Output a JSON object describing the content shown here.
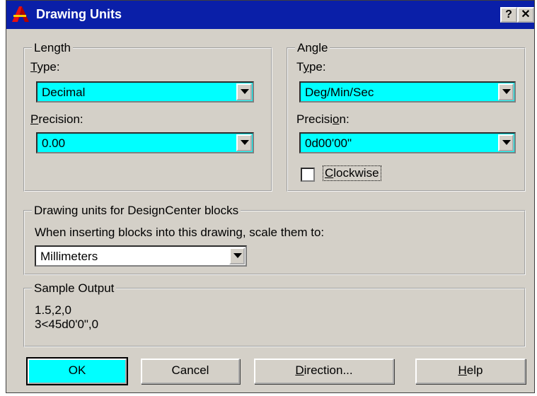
{
  "window": {
    "title": "Drawing Units",
    "help_label": "?",
    "close_label": "✕",
    "icons": {
      "app": "autocad-logo-icon",
      "help": "help-icon",
      "close": "close-icon"
    }
  },
  "length": {
    "legend": "Length",
    "type_label_pre": "",
    "type_label_u": "T",
    "type_label_post": "ype:",
    "type_value": "Decimal",
    "precision_label_pre": "",
    "precision_label_u": "P",
    "precision_label_post": "recision:",
    "precision_value": "0.00"
  },
  "angle": {
    "legend": "Angle",
    "type_label_pre": "T",
    "type_label_u": "y",
    "type_label_post": "pe:",
    "type_value": "Deg/Min/Sec",
    "precision_label_pre": "Precisi",
    "precision_label_u": "o",
    "precision_label_post": "n:",
    "precision_value": "0d00'00\"",
    "clockwise_label_u": "C",
    "clockwise_label_post": "lockwise",
    "clockwise_checked": false
  },
  "designcenter": {
    "legend": "Drawing units for DesignCenter blocks",
    "instruction": "When inserting blocks into this drawing, scale them to:",
    "units_value": "Millimeters"
  },
  "sample": {
    "legend": "Sample Output",
    "line1": "1.5,2,0",
    "line2": "3<45d0'0\",0"
  },
  "buttons": {
    "ok": "OK",
    "cancel": "Cancel",
    "direction_u": "D",
    "direction_post": "irection...",
    "help_u": "H",
    "help_post": "elp"
  },
  "colors": {
    "accent": "#00ffff",
    "titlebar": "#0a1fa8",
    "dialog": "#d4d0c8"
  }
}
